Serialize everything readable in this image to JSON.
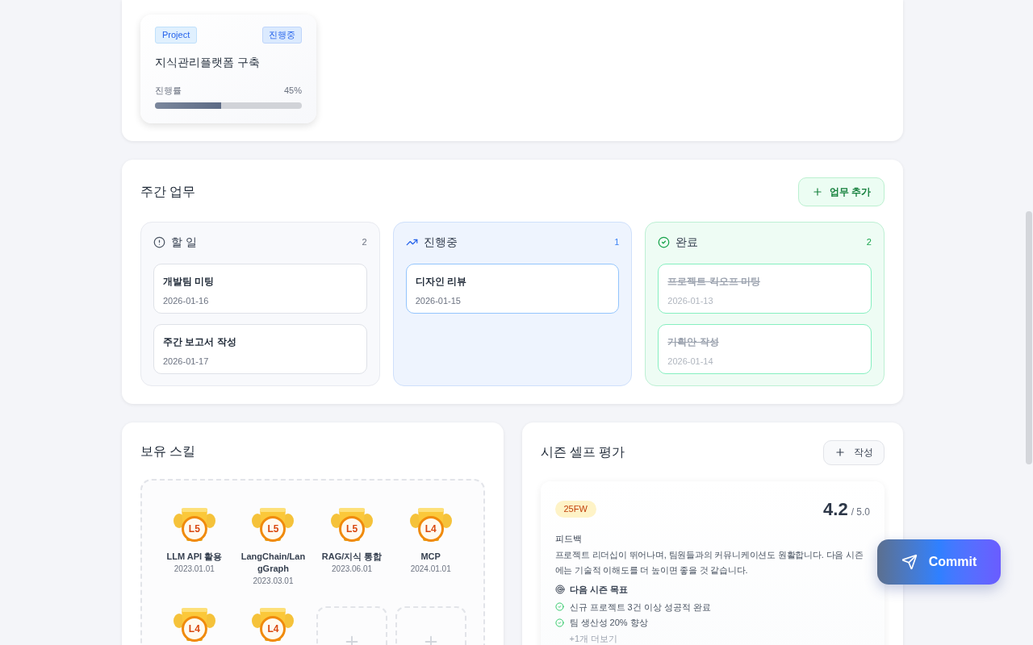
{
  "project_card": {
    "tag": "Project",
    "status": "진행중",
    "title": "지식관리플랫폼 구축",
    "progress_label": "진행률",
    "progress_value": "45%",
    "level": 0.45
  },
  "weekly": {
    "title": "주간 업무",
    "add_button": "업무 추가",
    "columns": [
      {
        "kind": "todo",
        "title": "할 일",
        "count": "2",
        "tasks": [
          {
            "title": "개발팀 미팅",
            "date": "2026-01-16",
            "completed": false
          },
          {
            "title": "주간 보고서 작성",
            "date": "2026-01-17",
            "completed": false
          }
        ]
      },
      {
        "kind": "progress",
        "title": "진행중",
        "count": "1",
        "tasks": [
          {
            "title": "디자인 리뷰",
            "date": "2026-01-15",
            "completed": false
          }
        ]
      },
      {
        "kind": "done",
        "title": "완료",
        "count": "2",
        "tasks": [
          {
            "title": "프로젝트 킥오프 미팅",
            "date": "2026-01-13",
            "completed": true
          },
          {
            "title": "기획안 작성",
            "date": "2026-01-14",
            "completed": true
          }
        ]
      }
    ]
  },
  "skills": {
    "title": "보유 스킬",
    "items": [
      {
        "kind": "skill",
        "level": "L5",
        "name": "LLM API 활용",
        "date": "2023.01.01"
      },
      {
        "kind": "skill",
        "level": "L5",
        "name": "LangChain/LangGraph",
        "date": "2023.03.01"
      },
      {
        "kind": "skill",
        "level": "L5",
        "name": "RAG/지식 통합",
        "date": "2023.06.01"
      },
      {
        "kind": "skill",
        "level": "L4",
        "name": "MCP",
        "date": "2024.01.01"
      },
      {
        "kind": "skill",
        "level": "L4"
      },
      {
        "kind": "skill",
        "level": "L4"
      },
      {
        "kind": "empty"
      },
      {
        "kind": "empty"
      }
    ]
  },
  "self_review": {
    "title": "시즌 셀프 평가",
    "write_button": "작성",
    "season": "25FW",
    "score": "4.2",
    "max_score": "/ 5.0",
    "feedback_label": "피드백",
    "feedback": "프로젝트 리더십이 뛰어나며, 팀원들과의 커뮤니케이션도 원활합니다. 다음 시즌에는 기술적 이해도를 더 높이면 좋을 것 같습니다.",
    "goals_title": "다음 시즌 목표",
    "goals": [
      {
        "text": "신규 프로젝트 3건 이상 성공적 완료",
        "checked": true
      },
      {
        "text": "팀 생산성 20% 향상",
        "checked": true
      }
    ],
    "more": "+1개 더보기"
  },
  "commit_button": "Commit"
}
